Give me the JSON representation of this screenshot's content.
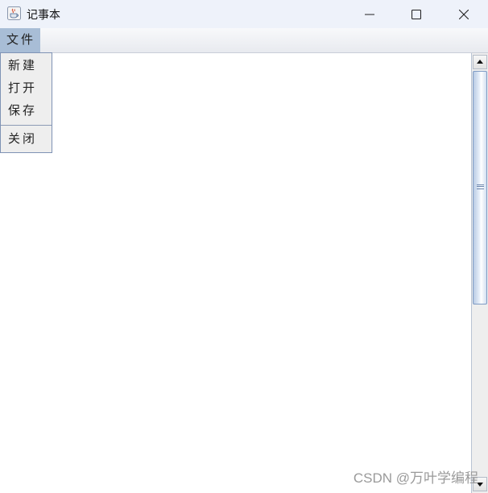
{
  "window": {
    "title": "记事本",
    "icon": "java-cup-icon",
    "controls": [
      "minimize-icon",
      "maximize-icon",
      "close-icon"
    ]
  },
  "menubar": {
    "menus": [
      {
        "label": "文件"
      }
    ]
  },
  "file_menu": {
    "items": [
      {
        "label": "新建"
      },
      {
        "label": "打开"
      },
      {
        "label": "保存"
      },
      {
        "label": "关闭"
      }
    ]
  },
  "editor": {
    "content": ""
  },
  "watermark": "CSDN @万叶学编程",
  "colors": {
    "titlebar": "#eef2fa",
    "menu_active": "#a8bdd6",
    "dropdown_bg": "#eeeeee",
    "scroll_thumb": "#b9cbe4"
  }
}
